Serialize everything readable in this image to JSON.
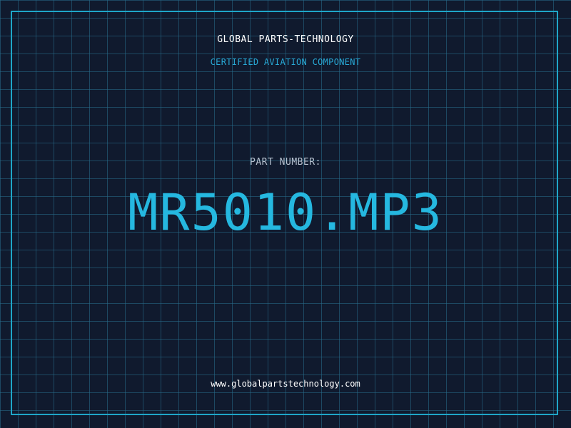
{
  "header": {
    "company": "GLOBAL PARTS-TECHNOLOGY",
    "subtitle": "CERTIFIED AVIATION COMPONENT"
  },
  "part": {
    "label": "PART NUMBER:",
    "number": "MR5010.MP3"
  },
  "footer": {
    "url": "www.globalpartstechnology.com"
  },
  "colors": {
    "background": "#101a2e",
    "grid": "#286e8c",
    "accent": "#25b8e0",
    "frame": "#1ea6c8"
  }
}
